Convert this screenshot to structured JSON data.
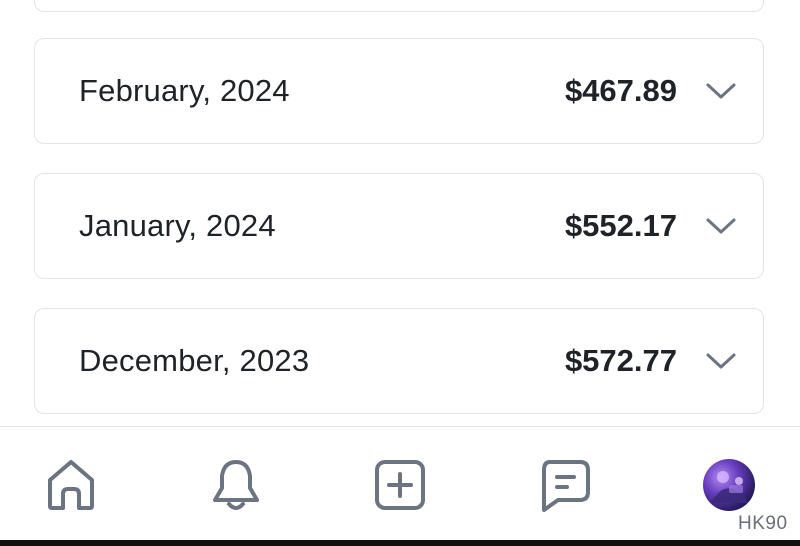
{
  "months": [
    {
      "label": "",
      "amount": ""
    },
    {
      "label": "February, 2024",
      "amount": "$467.89"
    },
    {
      "label": "January, 2024",
      "amount": "$552.17"
    },
    {
      "label": "December, 2023",
      "amount": "$572.77"
    }
  ],
  "nav": {
    "items": [
      {
        "icon": "home-icon"
      },
      {
        "icon": "bell-icon"
      },
      {
        "icon": "plus-square-icon"
      },
      {
        "icon": "message-icon"
      },
      {
        "icon": "avatar"
      }
    ],
    "profile_label": "HK90"
  },
  "colors": {
    "text": "#1f2328",
    "icon": "#6b7480",
    "border": "#e2e4e8",
    "background": "#ffffff"
  }
}
